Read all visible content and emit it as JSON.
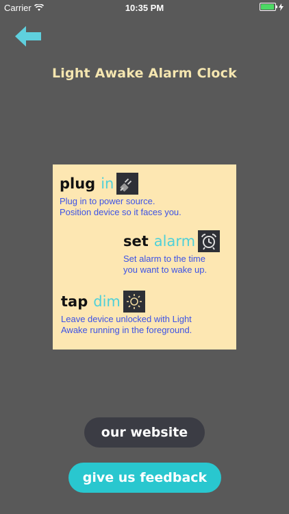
{
  "status_bar": {
    "carrier": "Carrier",
    "time": "10:35 PM",
    "battery_color": "#4cd964"
  },
  "header": {
    "back_icon": "arrow-left-icon",
    "title": "Light Awake Alarm Clock"
  },
  "instructions": [
    {
      "word1": "plug",
      "word2": "in",
      "icon": "plug-icon",
      "lines": [
        "Plug in to power source.",
        "Position device so it faces you."
      ]
    },
    {
      "word1": "set",
      "word2": "alarm",
      "icon": "alarm-clock-icon",
      "lines": [
        "Set alarm to the time",
        "you want to wake up."
      ]
    },
    {
      "word1": "tap",
      "word2": "dim",
      "icon": "sun-icon",
      "lines": [
        "Leave device unlocked with Light",
        "Awake running in the foreground."
      ]
    }
  ],
  "buttons": {
    "website": "our website",
    "feedback": "give us feedback"
  },
  "colors": {
    "background": "#595959",
    "title": "#f5e6b0",
    "card": "#fde7b2",
    "accent": "#29c7cf",
    "instruction_text": "#3c52e6"
  }
}
